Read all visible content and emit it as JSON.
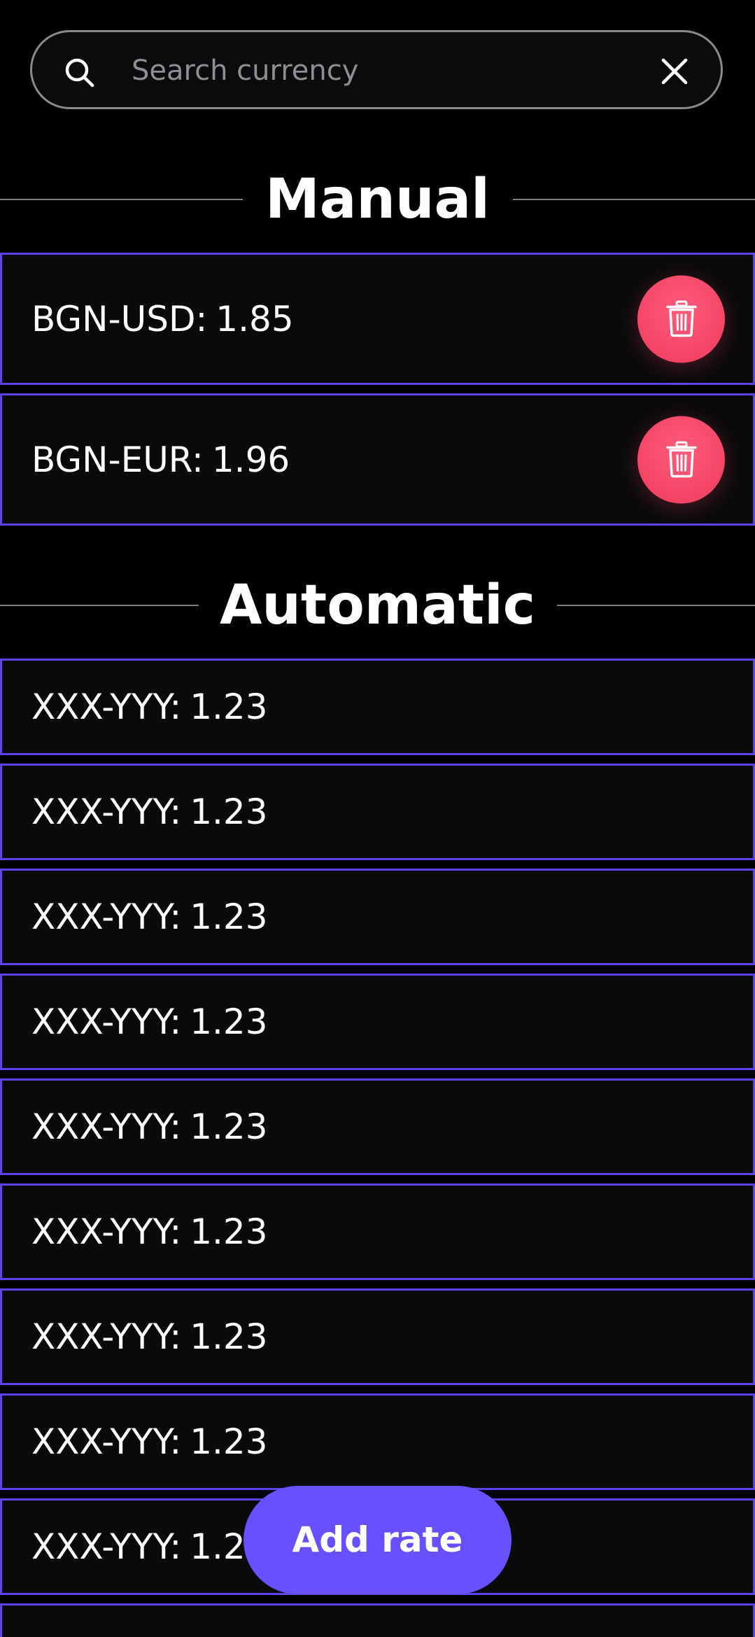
{
  "search": {
    "placeholder": "Search currency",
    "value": ""
  },
  "sections": {
    "manual": {
      "title": "Manual",
      "rows": [
        {
          "pair": "BGN-USD:",
          "value": "1.85"
        },
        {
          "pair": "BGN-EUR:",
          "value": "1.96"
        }
      ]
    },
    "automatic": {
      "title": "Automatic",
      "rows": [
        {
          "pair": "XXX-YYY:",
          "value": "1.23"
        },
        {
          "pair": "XXX-YYY:",
          "value": "1.23"
        },
        {
          "pair": "XXX-YYY:",
          "value": "1.23"
        },
        {
          "pair": "XXX-YYY:",
          "value": "1.23"
        },
        {
          "pair": "XXX-YYY:",
          "value": "1.23"
        },
        {
          "pair": "XXX-YYY:",
          "value": "1.23"
        },
        {
          "pair": "XXX-YYY:",
          "value": "1.23"
        },
        {
          "pair": "XXX-YYY:",
          "value": "1.23"
        },
        {
          "pair": "XXX-YYY:",
          "value": "1.23"
        },
        {
          "pair": "",
          "value": ""
        }
      ]
    }
  },
  "actions": {
    "add_rate_label": "Add rate"
  },
  "icons": {
    "search": "search-icon",
    "clear": "close-icon",
    "delete": "trash-icon"
  },
  "colors": {
    "background": "#000000",
    "row_background": "#0a0a0b",
    "row_border": "#5b45e8",
    "accent": "#6650ff",
    "delete": "#f44466",
    "divider": "#7d7d7d",
    "search_border": "#8a8a8a",
    "placeholder": "#8f8f93"
  }
}
